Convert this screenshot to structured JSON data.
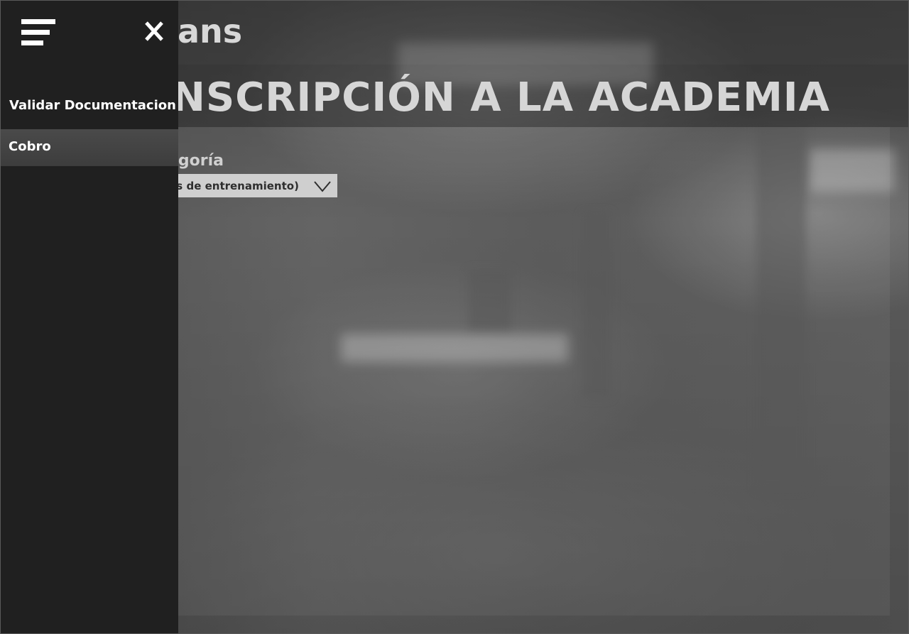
{
  "app": {
    "brand_partial": "ans"
  },
  "main": {
    "title": "NSCRIPCIÓN A LA ACADEMIA",
    "category_label": "egoría",
    "category_select_value": "os de entrenamiento)"
  },
  "drawer": {
    "items": [
      {
        "label": "Validar Documentacion",
        "active": false
      },
      {
        "label": "Cobro",
        "active": true
      }
    ]
  },
  "icons": {
    "menu": "hamburger-icon",
    "close": "close-icon",
    "select": "chevron-down-icon"
  },
  "colors": {
    "drawer_bg": "#202020",
    "active_item_bg": "#444444",
    "select_bg": "#cfcfcf",
    "title_text": "#d6d6d6"
  }
}
